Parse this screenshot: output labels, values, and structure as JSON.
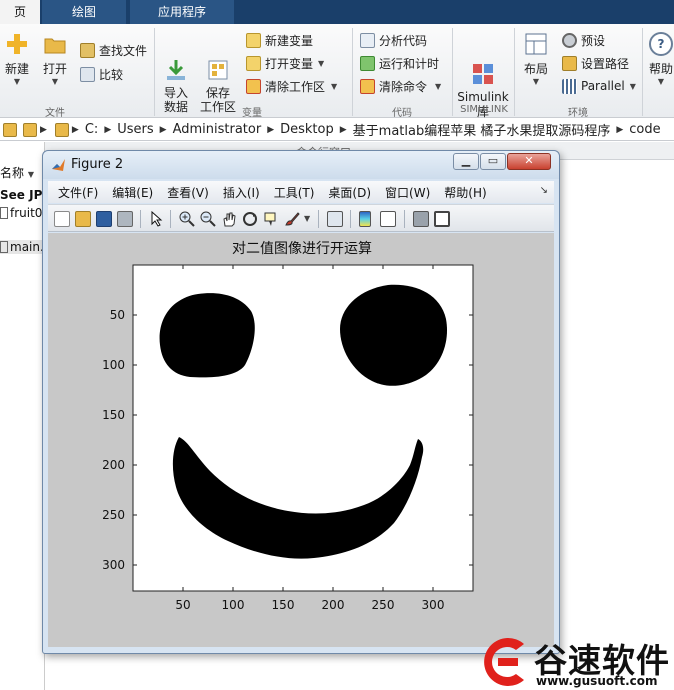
{
  "tabs": [
    {
      "label": "页"
    },
    {
      "label": "绘图"
    },
    {
      "label": "应用程序"
    }
  ],
  "ribbon": {
    "file": {
      "new_label": "新建",
      "open_label": "打开",
      "find_files_label": "查找文件",
      "compare_label": "比较",
      "section": "文件"
    },
    "variable": {
      "import_label": "导入\n数据",
      "save_ws_label": "保存\n工作区",
      "new_var_label": "新建变量",
      "open_var_label": "打开变量",
      "clear_ws_label": "清除工作区",
      "section": "变量"
    },
    "code": {
      "analyze_label": "分析代码",
      "run_time_label": "运行和计时",
      "clear_cmd_label": "清除命令",
      "section": "代码"
    },
    "simulink": {
      "simulink_label": "Simulink\n库",
      "section": "SIMULINK"
    },
    "env": {
      "layout_label": "布局",
      "prefs_label": "预设",
      "set_path_label": "设置路径",
      "parallel_label": "Parallel",
      "help_label": "帮助",
      "section": "环境"
    }
  },
  "address": {
    "crumbs": [
      "C:",
      "Users",
      "Administrator",
      "Desktop",
      "基于matlab编程苹果 橘子水果提取源码程序",
      "code"
    ]
  },
  "left_panel": {
    "header": "件夹",
    "col_label": "名称",
    "see_label": "See JPI",
    "fruit_label": "fruit0",
    "main_label": "main."
  },
  "cmd_header": "命令行窗口",
  "figure": {
    "title": "Figure 2",
    "menus": [
      "文件(F)",
      "编辑(E)",
      "查看(V)",
      "插入(I)",
      "工具(T)",
      "桌面(D)",
      "窗口(W)",
      "帮助(H)"
    ],
    "axes_title": "对二值图像进行开运算",
    "x_ticks": [
      "50",
      "100",
      "150",
      "200",
      "250",
      "300"
    ],
    "y_ticks": [
      "50",
      "100",
      "150",
      "200",
      "250",
      "300"
    ]
  },
  "watermark": {
    "title": "谷速软件",
    "url": "www.gusuoft.com"
  },
  "colors": {
    "tabstrip": "#1a3f6a",
    "close_button": "#c9412f",
    "watermark_red": "#e0211c"
  }
}
